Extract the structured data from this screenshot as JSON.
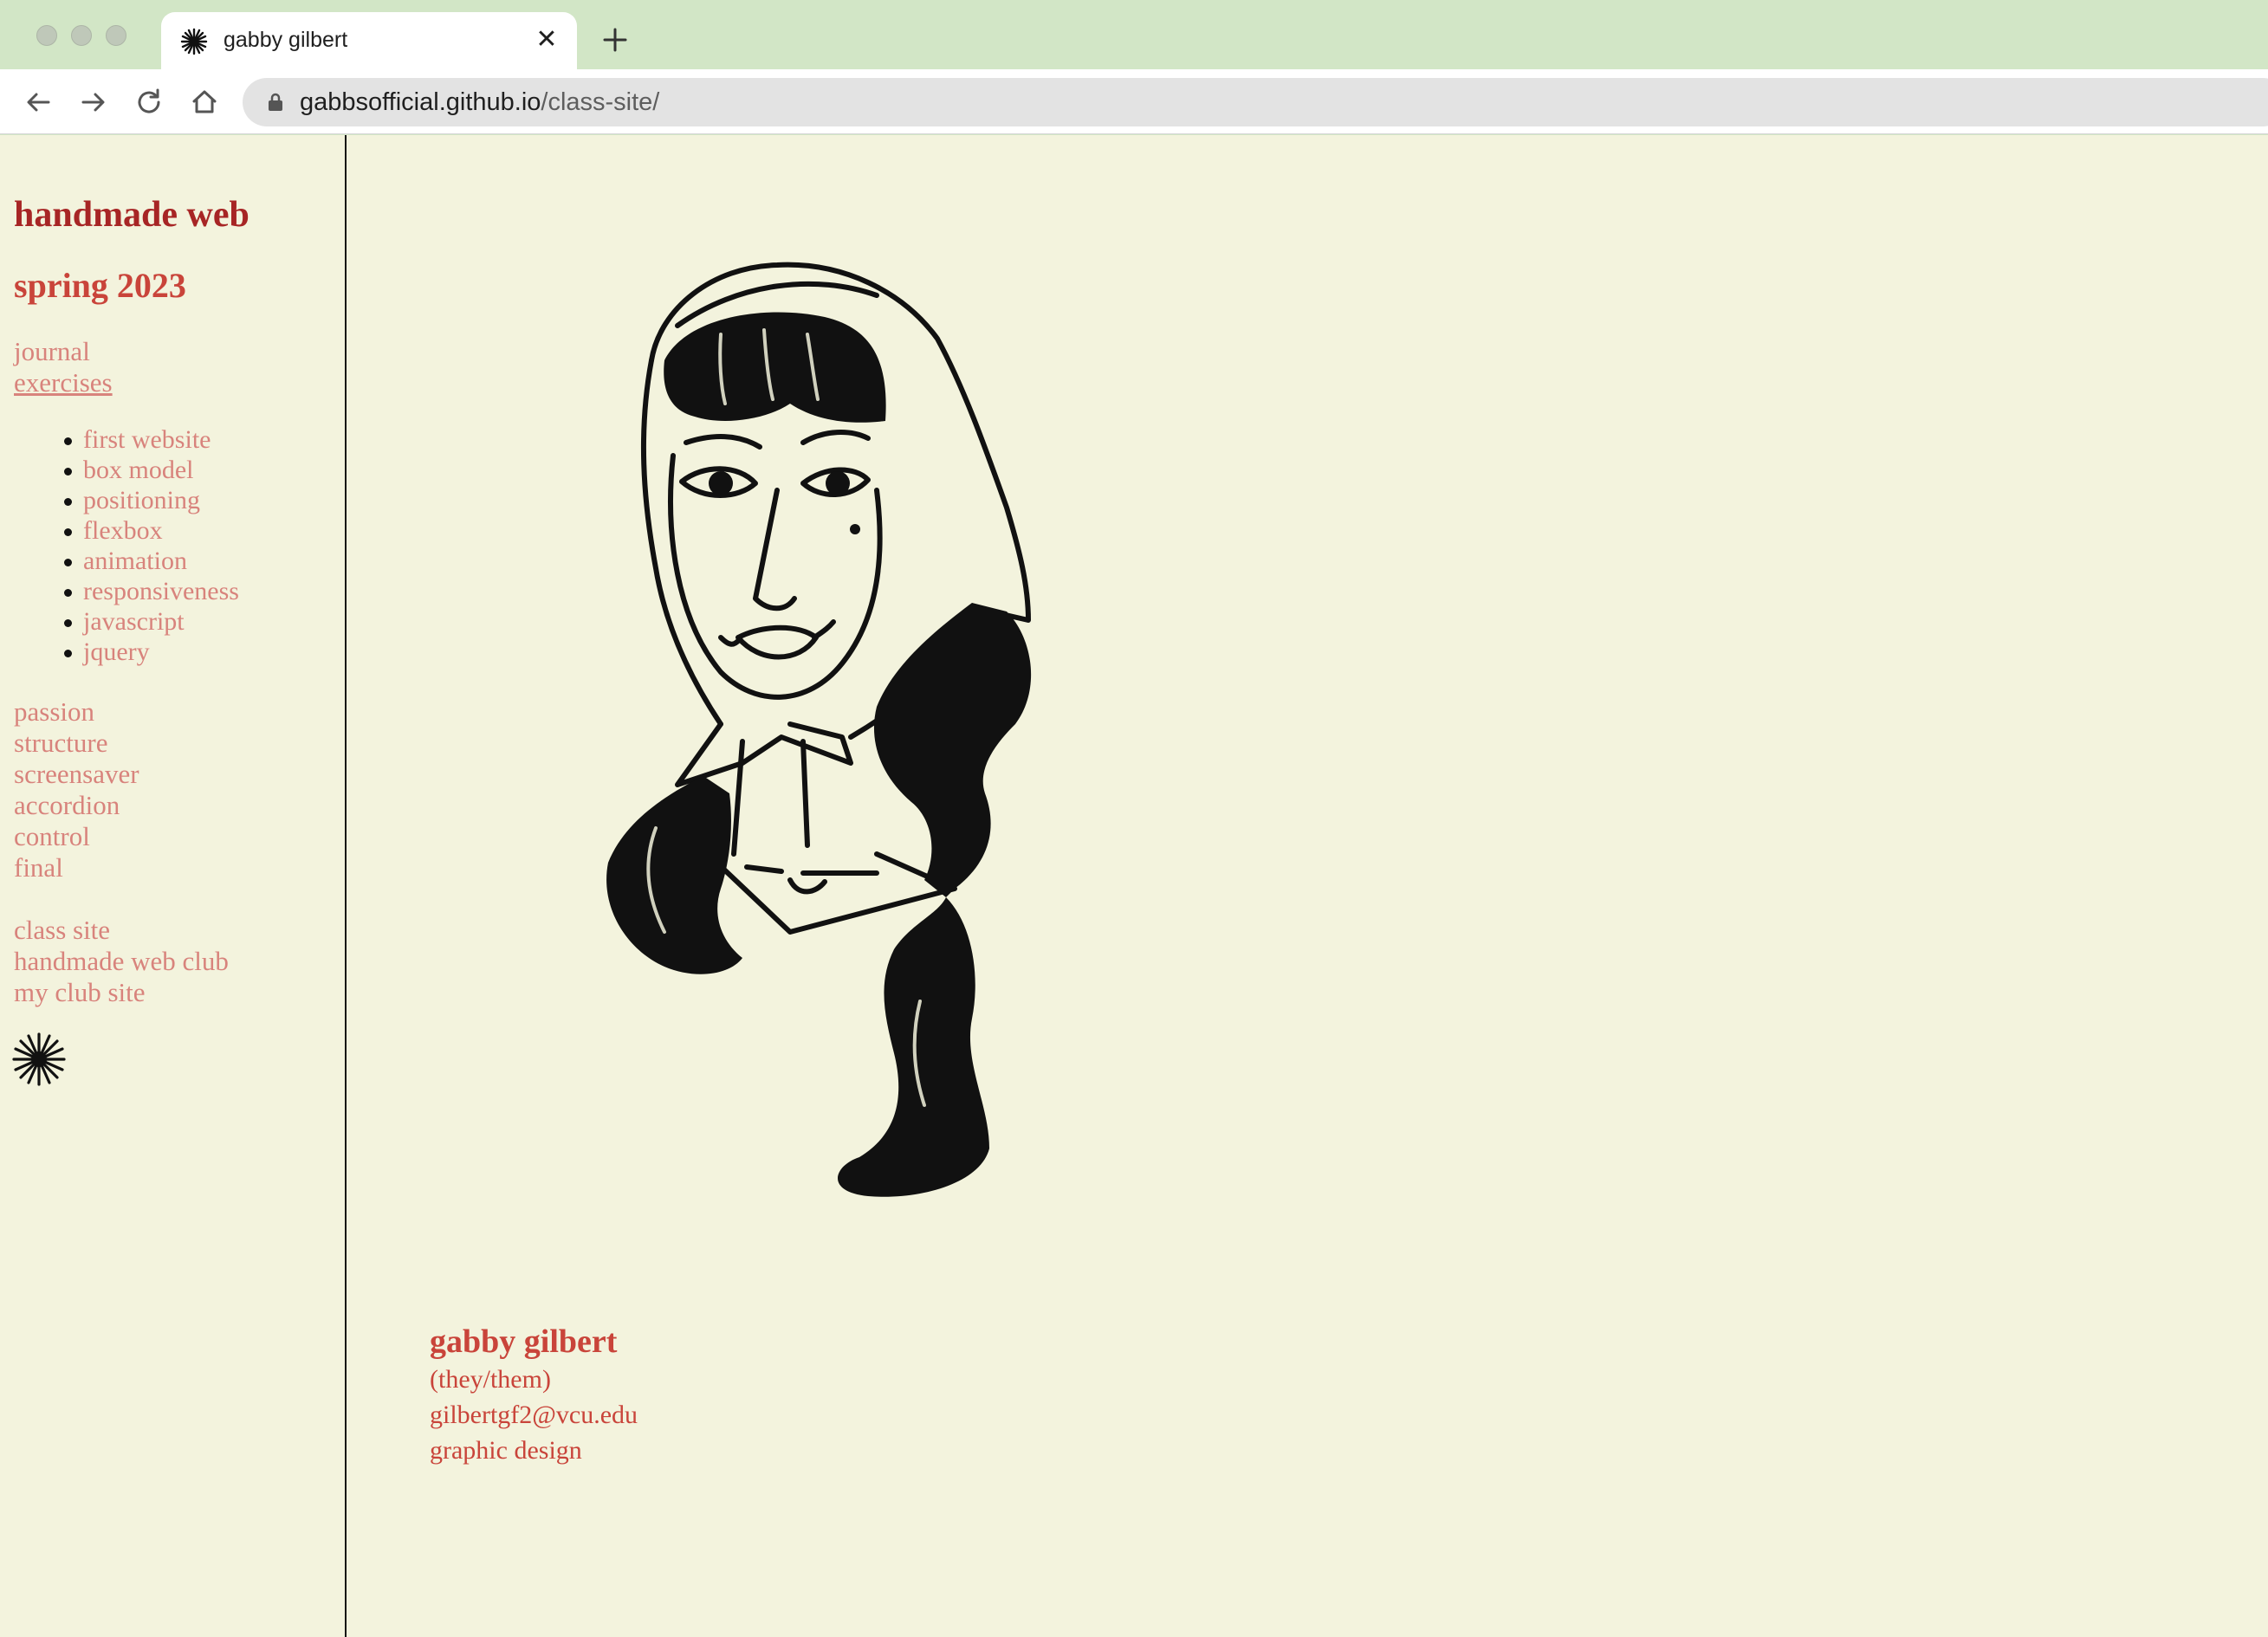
{
  "browser": {
    "tab_title": "gabby gilbert",
    "tab_icon": "asterisk-star-icon",
    "url_host": "gabbsofficial.github.io",
    "url_path": "/class-site/"
  },
  "sidebar": {
    "title": "handmade web",
    "subtitle": "spring 2023",
    "links_top": [
      {
        "label": "journal"
      },
      {
        "label": "exercises"
      }
    ],
    "exercises": [
      {
        "label": "first website"
      },
      {
        "label": "box model"
      },
      {
        "label": "positioning"
      },
      {
        "label": "flexbox"
      },
      {
        "label": "animation"
      },
      {
        "label": "responsiveness"
      },
      {
        "label": "javascript"
      },
      {
        "label": "jquery"
      }
    ],
    "projects": [
      {
        "label": "passion"
      },
      {
        "label": "structure"
      },
      {
        "label": "screensaver"
      },
      {
        "label": "accordion"
      },
      {
        "label": "control"
      },
      {
        "label": "final"
      }
    ],
    "external": [
      {
        "label": "class site"
      },
      {
        "label": "handmade web club"
      },
      {
        "label": "my club site"
      }
    ],
    "icon": "asterisk-star-icon"
  },
  "main": {
    "portrait_icon": "portrait-illustration",
    "name": "gabby gilbert",
    "pronouns": "(they/them)",
    "email": "gilbertgf2@vcu.edu",
    "program": "graphic design"
  },
  "colors": {
    "page_bg": "#f3f3dd",
    "title_red": "#a72525",
    "accent_red": "#c9443a",
    "link_pink": "#d8837c",
    "chrome_green": "#d2e6c6"
  }
}
